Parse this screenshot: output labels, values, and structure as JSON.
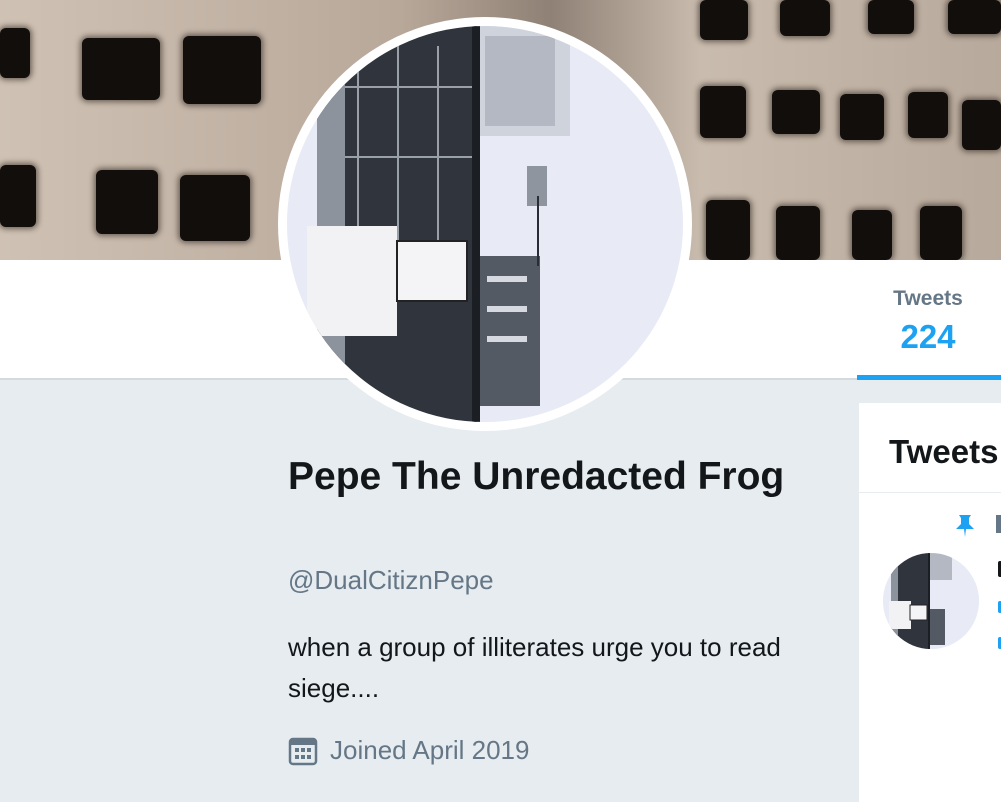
{
  "profile": {
    "name": "Pepe The Unredacted Frog",
    "handle": "@DualCitiznPepe",
    "bio": "when a group of illiterates urge you to read siege....",
    "joined": "Joined April 2019"
  },
  "nav": {
    "stats": [
      {
        "label": "Tweets",
        "value": "224"
      }
    ]
  },
  "tweets_panel": {
    "title": "Tweets"
  },
  "icons": {
    "joined": "calendar-icon",
    "pinned": "pin-icon"
  },
  "colors": {
    "accent": "#1da1f2",
    "secondary_text": "#657786",
    "background": "#e6ecf0"
  }
}
